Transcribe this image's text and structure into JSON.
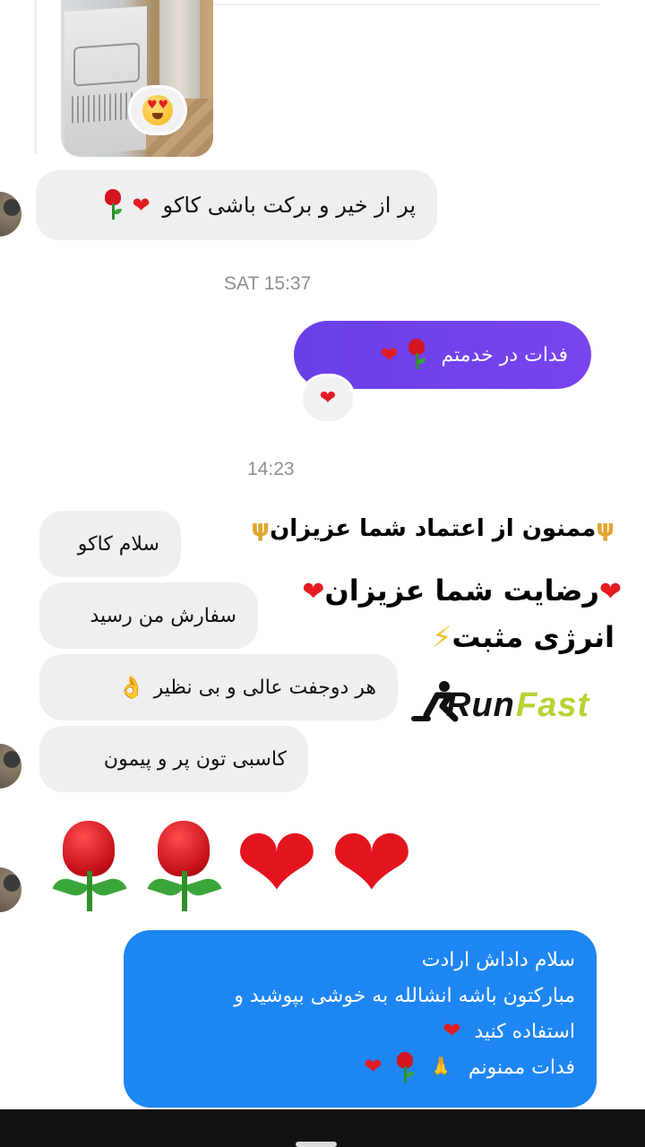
{
  "conversation": {
    "thread1": {
      "reply_text": "پر از خیر و برکت باشی کاکو",
      "timestamp": "SAT 15:37",
      "my_message": "فدات در خدمتم"
    },
    "thread2": {
      "timestamp": "14:23",
      "messages": [
        "سلام کاکو",
        "سفارش من رسید",
        "هر دوجفت عالی و بی نظیر",
        "کاسبی تون پر و پیمون"
      ]
    },
    "final_message": {
      "line1": "سلام داداش ارادت",
      "line2": "مبارکتون باشه انشالله به خوشی بپوشید و",
      "line3": "استفاده کنید",
      "line4": "فدات ممنونم"
    }
  },
  "overlay": {
    "line1": "ممنون از اعتماد شما عزیزان",
    "line2": "رضایت شما عزیزان",
    "line3": "انرژی مثبت",
    "logo_part1": "Run",
    "logo_part2": "Fast"
  },
  "icons": {
    "reaction_on_photo": "heart-eyes-emoji-icon",
    "reaction_on_message": "heart-icon",
    "rose": "rose-icon",
    "heart": "heart-icon",
    "ok_hand": "ok-hand-icon",
    "pray": "pray-icon",
    "trident": "trident-icon",
    "bolt": "lightning-icon"
  },
  "colors": {
    "outgoing_bubble": "#6a3fe8",
    "incoming_bubble": "#efefef",
    "blue_bubble": "#1e86f2",
    "logo_green": "#b5d334",
    "heart_red": "#e41b23"
  }
}
